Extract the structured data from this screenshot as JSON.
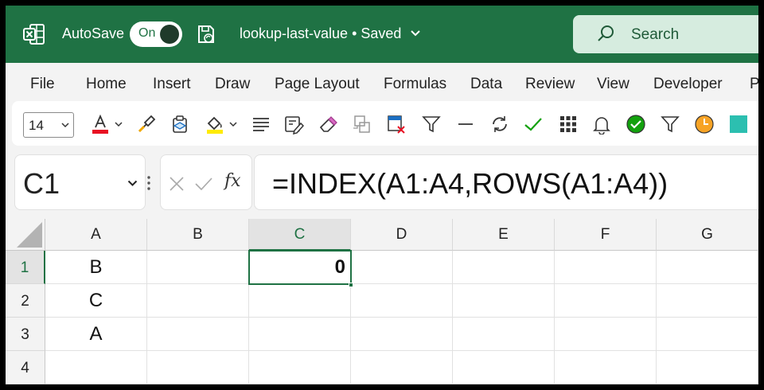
{
  "titlebar": {
    "autosave_label": "AutoSave",
    "autosave_state": "On",
    "file_title": "lookup-last-value • Saved",
    "search_placeholder": "Search",
    "accent_color": "#1f7244"
  },
  "menu": {
    "items": [
      "File",
      "Home",
      "Insert",
      "Draw",
      "Page Layout",
      "Formulas",
      "Data",
      "Review",
      "View",
      "Developer",
      "P"
    ]
  },
  "toolbar": {
    "font_size": "14",
    "icons": [
      "font-color-icon",
      "format-painter-icon",
      "paste-special-icon",
      "fill-color-icon",
      "align-icon",
      "edit-icon",
      "eraser-icon",
      "copy-format-icon",
      "clear-icon",
      "filter-icon",
      "minus-icon",
      "refresh-icon",
      "check-icon",
      "grid-icon",
      "bell-icon",
      "check-circle-icon",
      "filter-icon",
      "clock-icon",
      "teal-square-icon"
    ]
  },
  "formula_bar": {
    "name_box": "C1",
    "fx_label": "fx",
    "formula": "=INDEX(A1:A4,ROWS(A1:A4))"
  },
  "sheet": {
    "columns": [
      "A",
      "B",
      "C",
      "D",
      "E",
      "F",
      "G"
    ],
    "rows": [
      "1",
      "2",
      "3",
      "4"
    ],
    "cells": {
      "A1": "B",
      "A2": "C",
      "A3": "A",
      "C1": "0"
    },
    "active_cell": "C1"
  }
}
